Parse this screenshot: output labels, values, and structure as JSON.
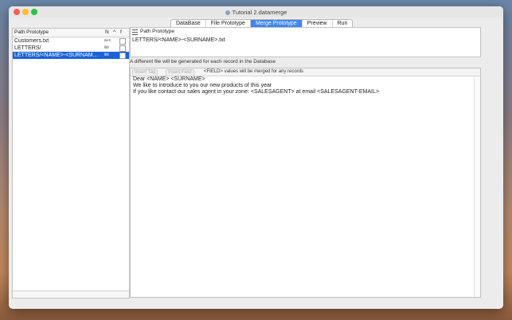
{
  "window": {
    "title": "Tutorial 2.datamerge"
  },
  "tabs": [
    {
      "label": "DataBase",
      "active": false
    },
    {
      "label": "File Prototype",
      "active": false
    },
    {
      "label": "Merge Prototype",
      "active": true
    },
    {
      "label": "Preview",
      "active": false
    },
    {
      "label": "Run",
      "active": false
    }
  ],
  "left_panel": {
    "header": {
      "col_path": "Path Prototype",
      "col_n": "N",
      "col_sort": "^",
      "col_f": "f"
    },
    "rows": [
      {
        "name": "Customers.txt",
        "n": "a+c",
        "selected": false
      },
      {
        "name": "LETTERS/",
        "n": "iiiii",
        "selected": false
      },
      {
        "name": "LETTERS/<NAME>-<SURNAME>....",
        "n": "iiiii",
        "selected": true
      }
    ]
  },
  "path_box": {
    "label": "Path Prototype",
    "value": "LETTERS/<NAME>-<SURNAME>.txt"
  },
  "note": "A different file will be generated for each record in the Database",
  "editor": {
    "insert_tag": "Insert Tag",
    "insert_field": "Insert Field",
    "merge_note": "<FIELD> values will be merged for any records",
    "lines": [
      "Dear <NAME> <SURNAME>",
      "We like to introduce to you our new products of this year",
      "If you like contact our sales agent in your zone: <SALESAGENT> at email <SALESAGENT-EMAIL>"
    ]
  },
  "colors": {
    "accent": "#3f86f5",
    "selection": "#1b63d8"
  }
}
